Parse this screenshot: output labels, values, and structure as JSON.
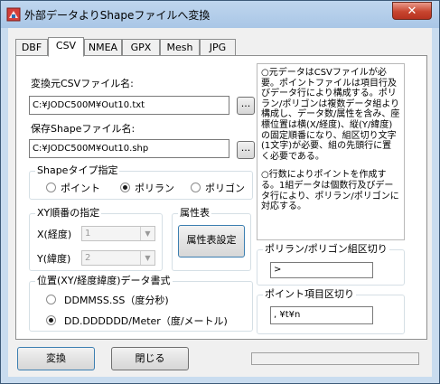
{
  "window": {
    "title": "外部データよりShapeファイルへ変換",
    "close_label": "✕"
  },
  "tabs": [
    {
      "label": "DBF"
    },
    {
      "label": "CSV"
    },
    {
      "label": "NMEA"
    },
    {
      "label": "GPX"
    },
    {
      "label": "Mesh"
    },
    {
      "label": "JPG"
    }
  ],
  "source": {
    "label": "変換元CSVファイル名:",
    "value": "C:¥JODC500M¥Out10.txt",
    "browse_label": "..."
  },
  "dest": {
    "label": "保存Shapeファイル名:",
    "value": "C:¥JODC500M¥Out10.shp",
    "browse_label": "..."
  },
  "shape_type": {
    "title": "Shapeタイプ指定",
    "options": [
      "ポイント",
      "ポリラン",
      "ポリゴン"
    ],
    "selected": "ポリラン"
  },
  "xy_order": {
    "title": "XY順番の指定",
    "x_label": "X(経度)",
    "x_value": "1",
    "y_label": "Y(緯度)",
    "y_value": "2"
  },
  "attribute": {
    "title": "属性表",
    "button_label": "属性表設定"
  },
  "coord_format": {
    "title": "位置(XY/経度緯度)データ書式",
    "options": [
      "DDMMSS.SS（度分秒)",
      "DD.DDDDDD/Meter（度/メートル)"
    ],
    "selected": "DD.DDDDDD/Meter（度/メートル)"
  },
  "note": {
    "para1": "○元データはCSVファイルが必要。ポイントファイルは項目行及びデータ行により構成する。ポリラン/ポリゴンは複数データ組より構成し、データ数/属性を含み、座標位置は横(X/経度)、縦(Y/緯度)の固定順番になり、組区切り文字(1文字)が必要、組の先頭行に置く必要である。",
    "para2": "○行数によりポイントを作成する。1組データは個数行及びデータ行により、ポリラン/ポリゴンに対応する。"
  },
  "group_sep": {
    "title": "ポリラン/ポリゴン組区切り",
    "value": ">"
  },
  "field_sep": {
    "title": "ポイント項目区切り",
    "value": ", ¥t¥n"
  },
  "footer": {
    "convert_label": "変換",
    "close_label": "閉じる"
  },
  "colors": {
    "title_bar": "#a9c6e6",
    "close_button": "#c8452f",
    "panel": "#ffffff",
    "frame": "#f0f0f0"
  }
}
